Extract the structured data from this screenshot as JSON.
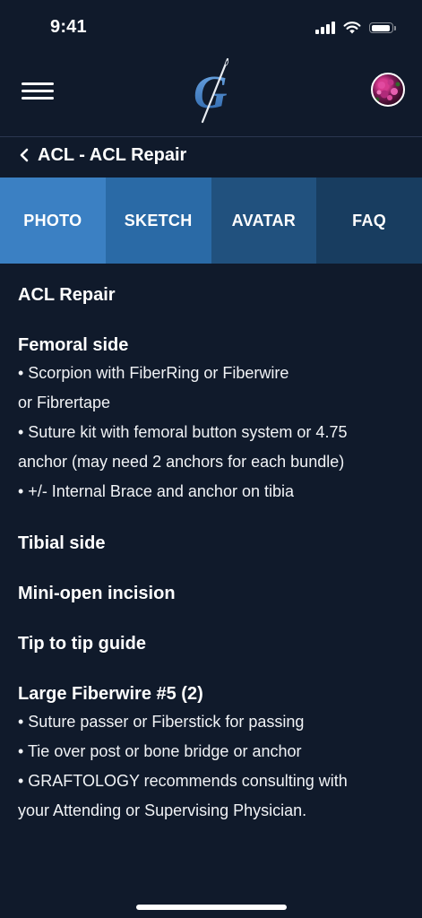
{
  "status_bar": {
    "time": "9:41"
  },
  "header": {
    "menu_icon": "hamburger-menu-icon",
    "logo_icon": "graftology-g-needle-logo",
    "avatar_icon": "user-avatar-flower"
  },
  "breadcrumb": {
    "back_icon": "chevron-left-icon",
    "title": "ACL - ACL Repair"
  },
  "tabs": [
    {
      "label": "PHOTO",
      "color": "#3b80c3"
    },
    {
      "label": "SKETCH",
      "color": "#2a6aa6"
    },
    {
      "label": "AVATAR",
      "color": "#21517e"
    },
    {
      "label": "FAQ",
      "color": "#183d60"
    }
  ],
  "content": {
    "title": "ACL Repair",
    "femoral": {
      "heading": "Femoral side",
      "lines": [
        "• Scorpion with FiberRing or Fiberwire",
        "or Fibrertape",
        "• Suture kit with femoral button system or 4.75",
        "anchor  (may need 2 anchors for each bundle)",
        "• +/- Internal Brace and anchor on tibia"
      ]
    },
    "tibial_heading": "Tibial side",
    "mini_open_heading": "Mini-open incision",
    "tip_heading": "Tip to tip guide",
    "fiberwire": {
      "heading": "Large Fiberwire #5 (2)",
      "lines": [
        "• Suture passer or Fiberstick for passing",
        "• Tie over post or bone bridge or anchor",
        "• GRAFTOLOGY recommends consulting with",
        "your Attending or Supervising Physician."
      ]
    }
  }
}
